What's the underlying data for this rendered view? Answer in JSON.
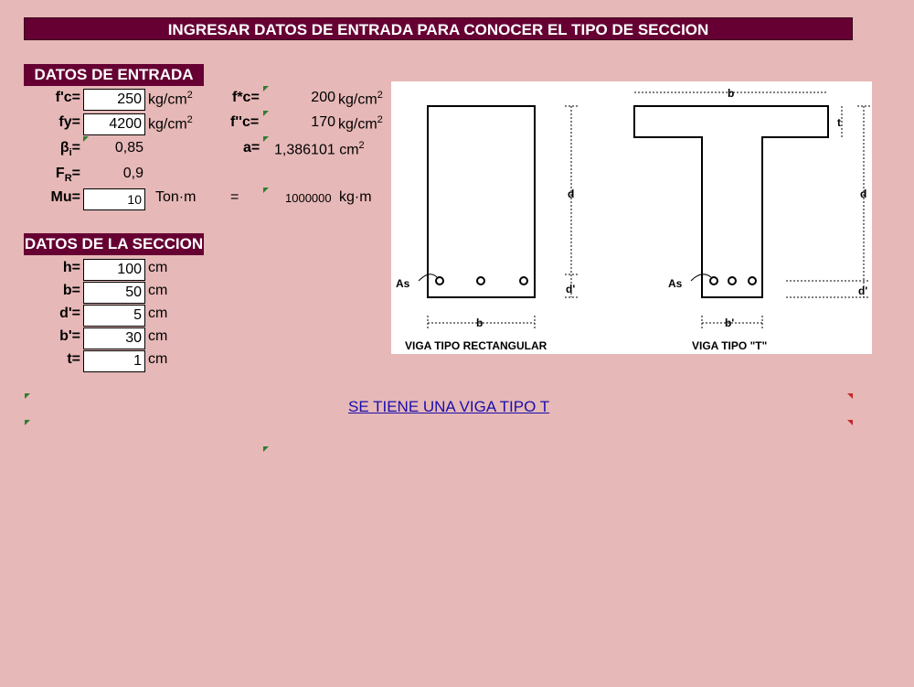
{
  "title": "INGRESAR DATOS DE ENTRADA PARA CONOCER EL TIPO DE SECCION",
  "datos_entrada": {
    "header": "DATOS DE ENTRADA",
    "fc": {
      "label": "f'c=",
      "value": "250",
      "unit": "kg/cm"
    },
    "fy": {
      "label": "fy=",
      "value": "4200",
      "unit": "kg/cm"
    },
    "beta": {
      "label": "β",
      "sub": "i",
      "eq": "=",
      "value": "0,85"
    },
    "fr": {
      "label": "F",
      "sub": "R",
      "eq": "=",
      "value": "0,9"
    },
    "mu": {
      "label": "Mu=",
      "value": "10",
      "unit": "Ton·m",
      "equals": "=",
      "converted": "1000000",
      "converted_unit": "kg·m"
    },
    "fstar": {
      "label": "f*c=",
      "value": "200",
      "unit": "kg/cm"
    },
    "fdouble": {
      "label": "f''c=",
      "value": "170",
      "unit": "kg/cm"
    },
    "a": {
      "label": "a=",
      "value": "1,386101",
      "unit": "cm"
    },
    "exp": "2"
  },
  "datos_seccion": {
    "header": "DATOS DE LA SECCION",
    "rows": [
      {
        "label": "h=",
        "value": "100",
        "unit": "cm"
      },
      {
        "label": "b=",
        "value": "50",
        "unit": "cm"
      },
      {
        "label": "d'=",
        "value": "5",
        "unit": "cm"
      },
      {
        "label": "b'=",
        "value": "30",
        "unit": "cm"
      },
      {
        "label": "t=",
        "value": "1",
        "unit": "cm"
      }
    ]
  },
  "diagram": {
    "rect_caption": "VIGA TIPO RECTANGULAR",
    "t_caption": "VIGA TIPO \"T\"",
    "as": "As",
    "b": "b",
    "bprime": "b'",
    "d": "d",
    "dprime": "d'",
    "t": "t"
  },
  "result": "SE TIENE UNA VIGA TIPO T"
}
